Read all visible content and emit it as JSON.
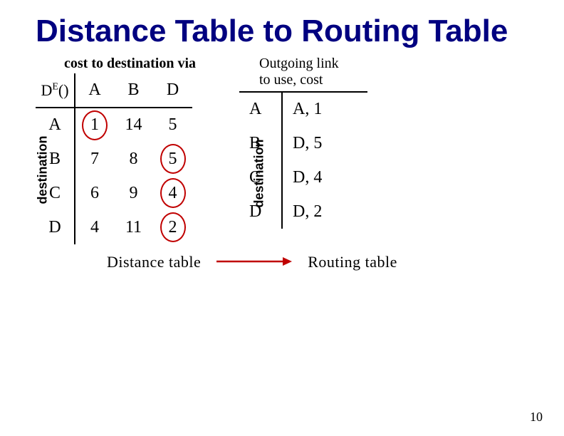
{
  "title": "Distance Table to Routing Table",
  "left": {
    "cost_label": "cost to destination via",
    "corner_d": "D",
    "corner_e": "E",
    "corner_paren": "()",
    "col_headers": [
      "A",
      "B",
      "D"
    ],
    "row_headers": [
      "A",
      "B",
      "C",
      "D"
    ],
    "cells": {
      "r0c0": "1",
      "r0c1": "14",
      "r0c2": "5",
      "r1c0": "7",
      "r1c1": "8",
      "r1c2": "5",
      "r2c0": "6",
      "r2c1": "9",
      "r2c2": "4",
      "r3c0": "4",
      "r3c1": "11",
      "r3c2": "2"
    },
    "y_label": "destination",
    "caption": "Distance table"
  },
  "right": {
    "out_label_line1": "Outgoing link",
    "out_label_line2": "to use, cost",
    "rows": {
      "d0": "A",
      "v0": "A, 1",
      "d1": "B",
      "v1": "D, 5",
      "d2": "C",
      "v2": "D, 4",
      "d3": "D",
      "v3": "D, 2"
    },
    "y_label": "destination",
    "caption": "Routing table"
  },
  "page_num": "10",
  "chart_data": {
    "type": "table",
    "title": "Distance Table to Routing Table",
    "distance_table": {
      "row_label": "destination",
      "col_label": "cost to destination via",
      "columns": [
        "A",
        "B",
        "D"
      ],
      "rows": [
        "A",
        "B",
        "C",
        "D"
      ],
      "values": [
        [
          1,
          14,
          5
        ],
        [
          7,
          8,
          5
        ],
        [
          6,
          9,
          4
        ],
        [
          4,
          11,
          2
        ]
      ],
      "circled_min_per_row": [
        {
          "row": "A",
          "via": "A",
          "cost": 1
        },
        {
          "row": "B",
          "via": "D",
          "cost": 5
        },
        {
          "row": "C",
          "via": "D",
          "cost": 4
        },
        {
          "row": "D",
          "via": "D",
          "cost": 2
        }
      ]
    },
    "routing_table": {
      "columns": [
        "destination",
        "outgoing link, cost"
      ],
      "rows": [
        {
          "dest": "A",
          "link": "A",
          "cost": 1
        },
        {
          "dest": "B",
          "link": "D",
          "cost": 5
        },
        {
          "dest": "C",
          "link": "D",
          "cost": 4
        },
        {
          "dest": "D",
          "link": "D",
          "cost": 2
        }
      ]
    }
  }
}
